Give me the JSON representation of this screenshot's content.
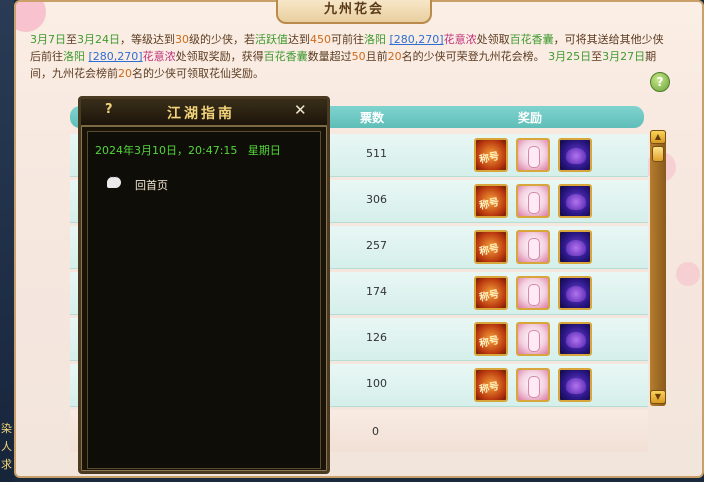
{
  "window": {
    "title": "九州花会"
  },
  "left_strip": {
    "chars": [
      "染",
      "人",
      "求"
    ]
  },
  "description": {
    "seg1": "3月7日",
    "seg2": "至",
    "seg3": "3月24日",
    "seg4": "，等级达到",
    "seg5": "30",
    "seg6": "级的少侠，若",
    "seg7": "活跃值",
    "seg8": "达到",
    "seg9": "450",
    "seg10": "可前往",
    "seg11": "洛阳",
    "seg12": "[280,270]",
    "seg13": "花意浓",
    "seg14": "处领取",
    "seg15": "百花香囊",
    "seg16": "，可将其送给其他少侠后前往",
    "seg17": "洛阳",
    "seg18": "[280,270]",
    "seg19": "花意浓",
    "seg20": "处领取奖励，获得",
    "seg21": "百花香囊",
    "seg22": "数量超过",
    "seg23": "50",
    "seg24": "且前",
    "seg25": "20",
    "seg26": "名的少侠可荣登九州花会榜。",
    "seg27": "3月25日",
    "seg28": "至",
    "seg29": "3月27日",
    "seg30": "期间，九州花会榜前",
    "seg31": "20",
    "seg32": "名的少侠可领取花仙奖励。"
  },
  "help_button": {
    "label": "?"
  },
  "table": {
    "headers": {
      "count": "票数",
      "reward": "奖励"
    },
    "rows": [
      {
        "count": "511"
      },
      {
        "count": "306"
      },
      {
        "count": "257"
      },
      {
        "count": "174"
      },
      {
        "count": "126"
      },
      {
        "count": "100"
      }
    ],
    "last_row": {
      "count": "0"
    },
    "reward_title_text": "称号"
  },
  "scrollbar": {
    "up": "▲",
    "down": "▼"
  },
  "guide": {
    "help": "?",
    "title": "江湖指南",
    "close": "✕",
    "datetime": "2024年3月10日，20:47:15",
    "weekday": "星期日",
    "home_link": "回首页"
  },
  "colors": {
    "accent": "#5fbdb8",
    "gold": "#d9a63b",
    "date_green": "#53d63c"
  }
}
